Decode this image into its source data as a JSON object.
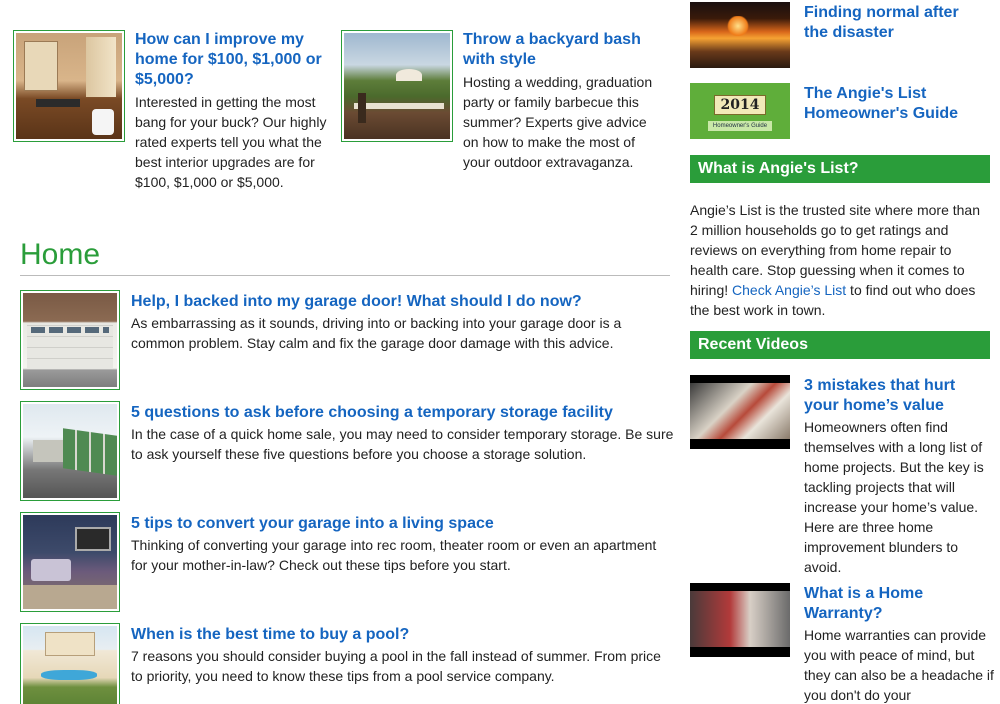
{
  "features": [
    {
      "title": "How can I improve my home for $100, $1,000 or $5,000?",
      "desc": "Interested in getting the most bang for your buck? Our highly rated experts tell you what the best interior upgrades are for $100, $1,000 or $5,000.",
      "image_icon": "bathroom-photo"
    },
    {
      "title": "Throw a backyard bash with style",
      "desc": "Hosting a wedding, graduation party or family barbecue this summer? Experts give advice on how to make the most of your outdoor extravaganza.",
      "image_icon": "backyard-deck-photo"
    }
  ],
  "home_section": {
    "heading": "Home",
    "articles": [
      {
        "title": "Help, I backed into my garage door! What should I do now?",
        "desc": "As embarrassing as it sounds, driving into or backing into your garage door is a common problem. Stay calm and fix the garage door damage with this advice.",
        "image_icon": "garage-door-photo"
      },
      {
        "title": "5 questions to ask before choosing a temporary storage facility",
        "desc": "In the case of a quick home sale, you may need to consider temporary storage. Be sure to ask yourself these five questions before you choose a storage solution.",
        "image_icon": "storage-units-photo"
      },
      {
        "title": "5 tips to convert your garage into a living space",
        "desc": "Thinking of converting your garage into rec room, theater room or even an apartment for your mother-in-law? Check out these tips before you start.",
        "image_icon": "converted-garage-photo"
      },
      {
        "title": "When is the best time to buy a pool?",
        "desc": "7 reasons you should consider buying a pool in the fall instead of summer. From price to priority, you need to know these tips from a pool service company.",
        "image_icon": "backyard-pool-photo"
      }
    ]
  },
  "sidebar": {
    "top_items": [
      {
        "title": "Finding normal after the disaster",
        "image_icon": "fire-photo"
      },
      {
        "title": "The Angie's List Homeowner's Guide",
        "image_icon": "homeowners-guide-photo",
        "guide_year": "2014",
        "guide_label": "Homeowner's Guide"
      }
    ],
    "about": {
      "heading": "What is Angie's List?",
      "text_before": "Angie’s List is the trusted site where more than 2 million households go to get ratings and reviews on everything from home repair to health care. Stop guessing when it comes to hiring! ",
      "link_text": "Check Angie’s List",
      "text_after": " to find out who does the best work in town."
    },
    "videos": {
      "heading": "Recent Videos",
      "items": [
        {
          "title": "3 mistakes that hurt your home’s value",
          "desc": "Homeowners often find themselves with a long list of home projects. But the key is tackling projects that will increase your home’s value. Here are three home improvement blunders to avoid.",
          "image_icon": "video-thumbnail"
        },
        {
          "title": "What is a Home Warranty?",
          "desc": "Home warranties can provide you with peace of mind, but they can also be a headache if you don't do your",
          "image_icon": "video-thumbnail"
        }
      ]
    }
  },
  "colors": {
    "brand_green": "#2a9d3a",
    "link_blue": "#1565c0"
  }
}
